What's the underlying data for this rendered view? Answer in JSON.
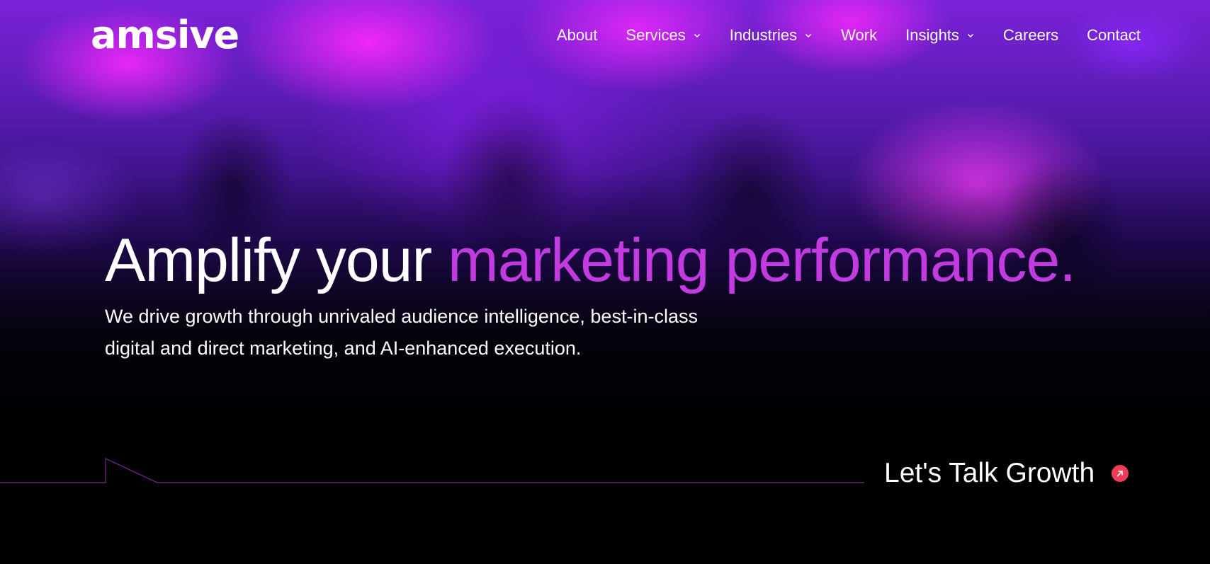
{
  "brand": {
    "logo_text": "amsive"
  },
  "nav": {
    "items": [
      {
        "label": "About",
        "has_dropdown": false
      },
      {
        "label": "Services",
        "has_dropdown": true
      },
      {
        "label": "Industries",
        "has_dropdown": true
      },
      {
        "label": "Work",
        "has_dropdown": false
      },
      {
        "label": "Insights",
        "has_dropdown": true
      },
      {
        "label": "Careers",
        "has_dropdown": false
      },
      {
        "label": "Contact",
        "has_dropdown": false
      }
    ],
    "dropdown_icon": "chevron-down-icon"
  },
  "hero": {
    "headline_white": "Amplify your ",
    "headline_accent": "marketing performance.",
    "subtext": "We drive growth through unrivaled audience intelligence, best-in-class digital and direct marketing, and AI-enhanced execution.",
    "cta_label": "Let's Talk Growth",
    "cta_icon": "arrow-up-right-icon"
  },
  "colors": {
    "accent": "#c23be0",
    "cta_icon_bg": "#f03b55",
    "text": "#ffffff",
    "deco_line": "#7a2a8c"
  }
}
